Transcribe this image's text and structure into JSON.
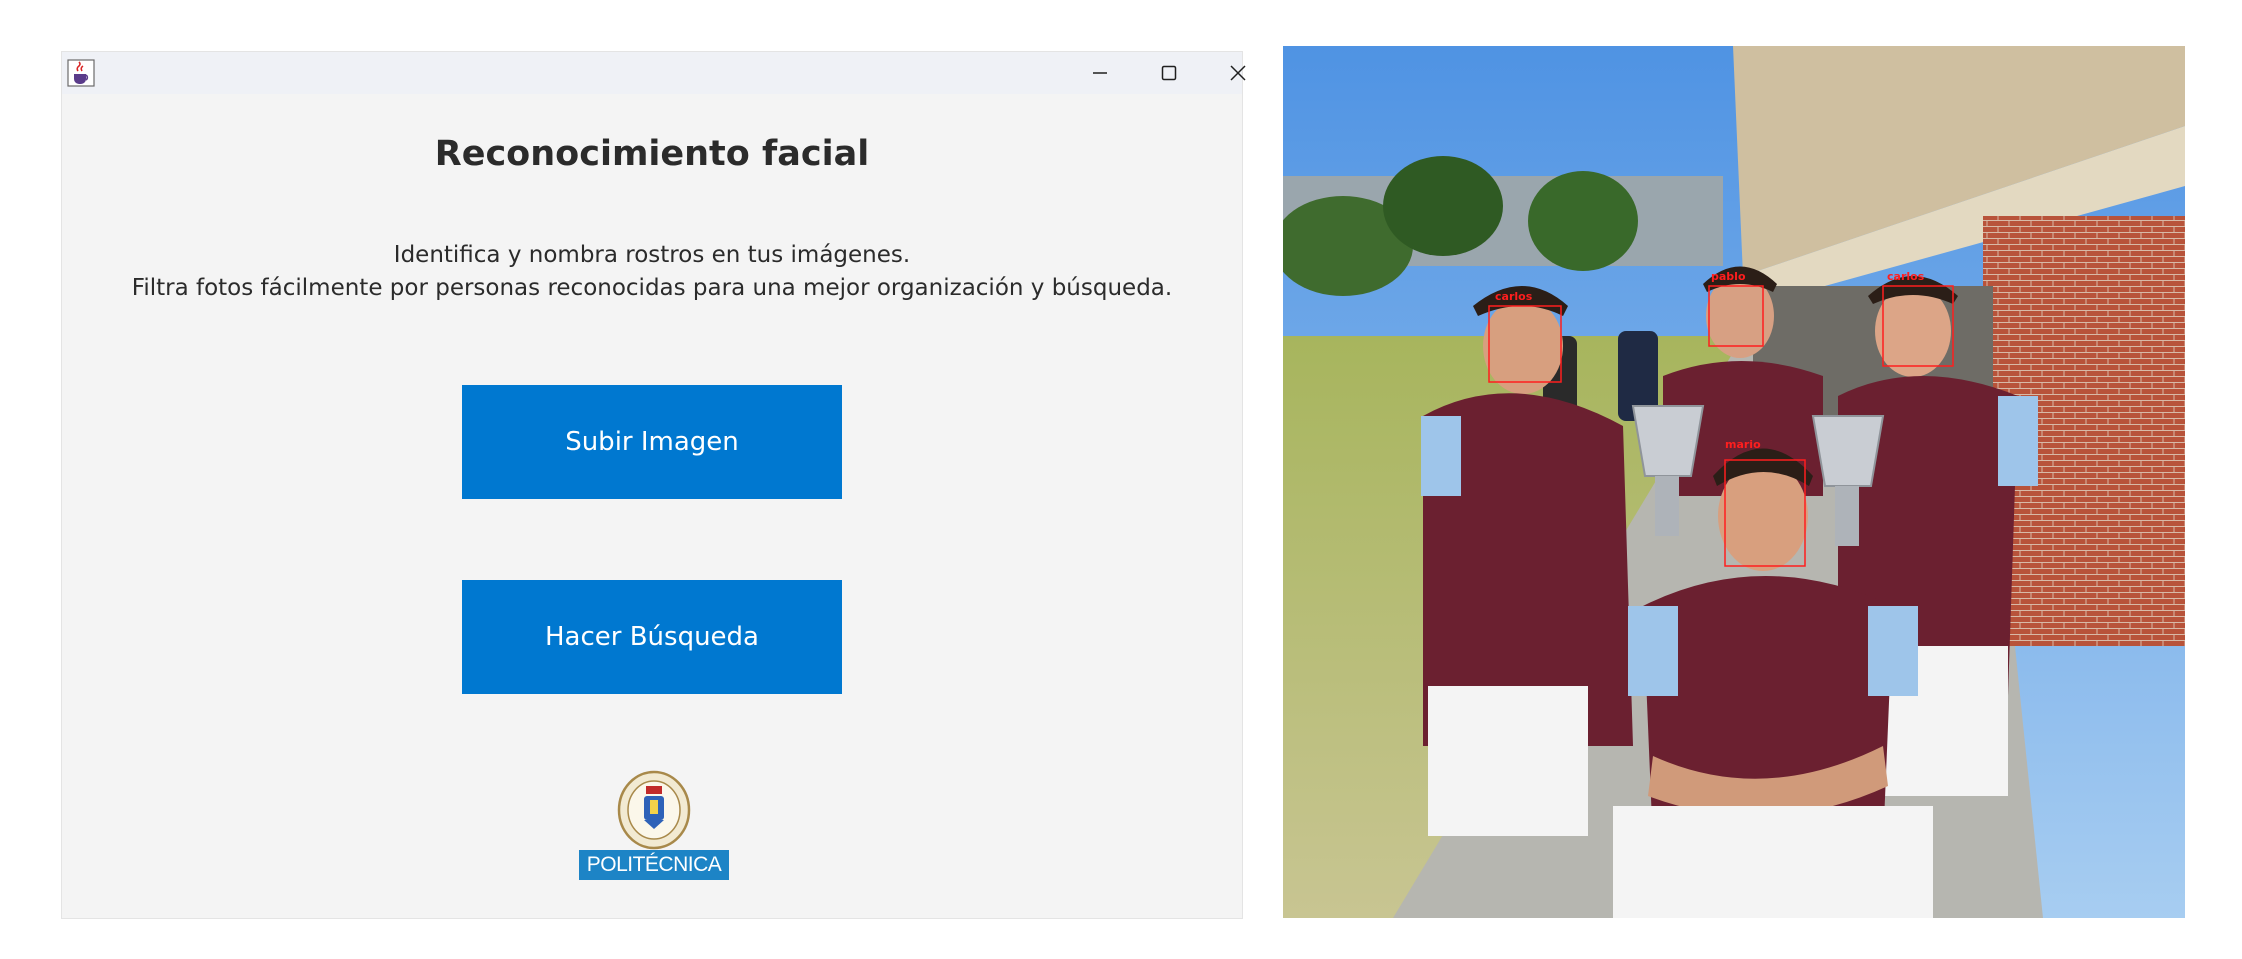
{
  "window": {
    "title_bar": {
      "app_icon": "java-cup-icon",
      "minimize_icon": "minimize-icon",
      "maximize_icon": "maximize-icon",
      "close_icon": "close-icon"
    },
    "heading": "Reconocimiento facial",
    "description_line1": "Identifica y nombra rostros en tus imágenes.",
    "description_line2": "Filtra fotos fácilmente por personas reconocidas para una mejor organización y búsqueda.",
    "buttons": {
      "upload_label": "Subir Imagen",
      "search_label": "Hacer Búsqueda"
    },
    "logo": {
      "text": "POLITÉCNICA"
    },
    "colors": {
      "button_bg": "#0078d0",
      "button_text": "#ffffff",
      "window_bg": "#f4f4f4",
      "titlebar_bg": "#eff1f6",
      "logo_band": "#1d84c6"
    }
  },
  "photo": {
    "face_labels": [
      "carlos",
      "pablo",
      "carlos",
      "mario"
    ],
    "box_color": "#ff1e1e"
  }
}
